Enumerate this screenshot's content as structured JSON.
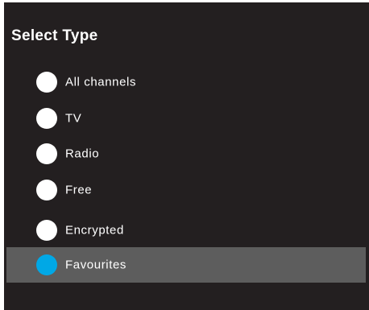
{
  "dialog": {
    "title": "Select Type",
    "options": [
      {
        "label": "All channels",
        "selected": false
      },
      {
        "label": "TV",
        "selected": false
      },
      {
        "label": "Radio",
        "selected": false
      },
      {
        "label": "Free",
        "selected": false
      },
      {
        "label": "Encrypted",
        "selected": false
      },
      {
        "label": "Favourites",
        "selected": true
      }
    ]
  },
  "colors": {
    "background": "#231f20",
    "highlight_row": "#5d5d5d",
    "selected_radio": "#00a8e6",
    "unselected_radio": "#ffffff",
    "text": "#ffffff"
  }
}
